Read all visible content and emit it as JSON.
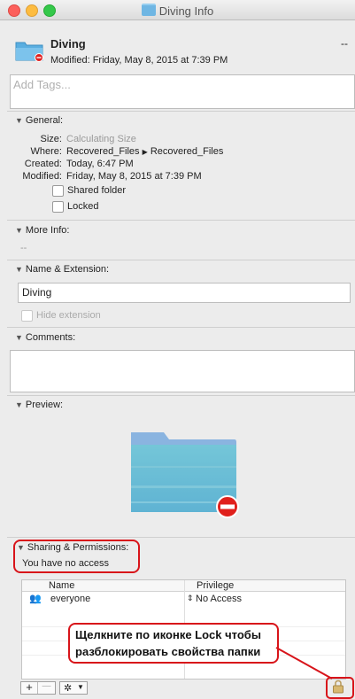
{
  "window": {
    "title": "Diving Info"
  },
  "header": {
    "name": "Diving",
    "modified": "Modified: Friday, May 8, 2015 at 7:39 PM",
    "dash": "--",
    "tags_placeholder": "Add Tags..."
  },
  "general": {
    "title": "General:",
    "size_label": "Size:",
    "size_value": "Calculating Size",
    "where_label": "Where:",
    "where_value_1": "Recovered_Files",
    "where_value_2": "Recovered_Files",
    "created_label": "Created:",
    "created_value": "Today, 6:47 PM",
    "modified_label": "Modified:",
    "modified_value": "Friday, May 8, 2015 at 7:39 PM",
    "shared_label": "Shared folder",
    "locked_label": "Locked"
  },
  "more_info": {
    "title": "More Info:",
    "value": "--"
  },
  "name_ext": {
    "title": "Name & Extension:",
    "value": "Diving",
    "hide_label": "Hide extension"
  },
  "comments": {
    "title": "Comments:"
  },
  "preview": {
    "title": "Preview:"
  },
  "sharing": {
    "title": "Sharing & Permissions:",
    "access": "You have no access",
    "col_name": "Name",
    "col_privilege": "Privilege",
    "rows": [
      {
        "name": "everyone",
        "privilege": "No Access"
      }
    ]
  },
  "annotation": {
    "line1": "Щелкните по иконке Lock чтобы",
    "line2": "разблокировать свойства папки"
  },
  "toolbar": {
    "add": "+",
    "remove": "—",
    "gear": "✲"
  },
  "colors": {
    "highlight": "#d8141a",
    "folder": "#6fb6e3"
  }
}
